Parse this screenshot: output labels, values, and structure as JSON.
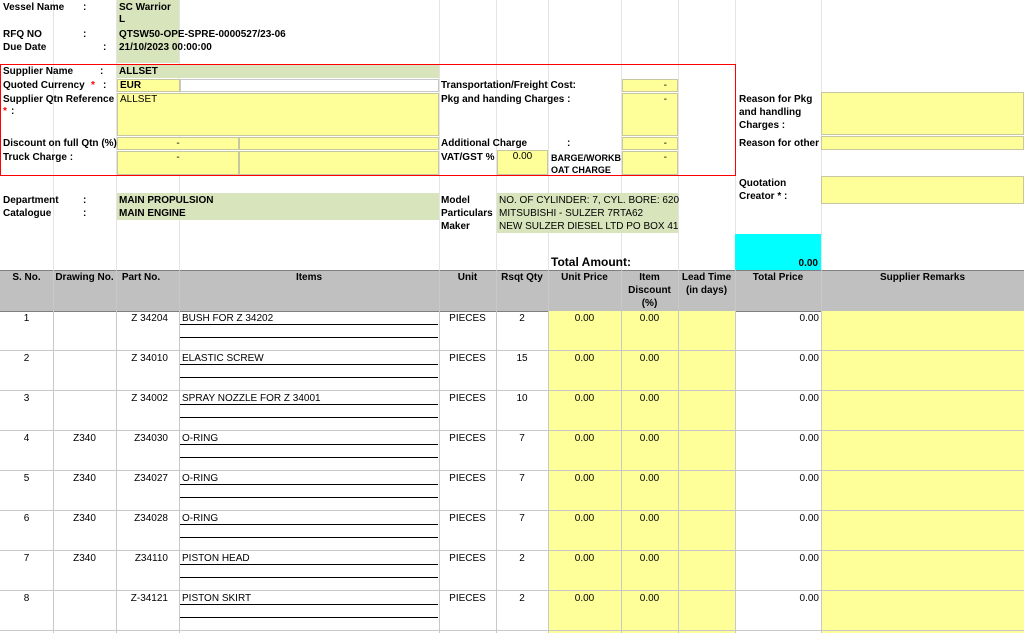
{
  "vessel": {
    "name_label": "Vessel Name",
    "name_line1": "SC Warrior",
    "name_line2": "L",
    "rfq_label": "RFQ NO",
    "rfq_value": "QTSW50-OPE-SPRE-0000527/23-06",
    "due_label": "Due Date",
    "due_value": "21/10/2023 00:00:00",
    "colon": ":"
  },
  "supplier": {
    "name_label": "Supplier Name",
    "name_value": "ALLSET",
    "currency_label": "Quoted Currency",
    "required_mark": "*",
    "currency_value": "EUR",
    "qtn_ref_label": "Supplier Qtn Reference",
    "qtn_ref_value": "ALLSET",
    "discount_label": "Discount on full Qtn  (%)",
    "discount_value": "-",
    "truck_label": "Truck Charge :",
    "truck_value": "-",
    "transport_label": "Transportation/Freight Cost:",
    "transport_value": "-",
    "pkg_label": "Pkg and handing Charges  :",
    "pkg_value": "-",
    "additional_label": "Additional Charge",
    "additional_value": "-",
    "vat_label": "VAT/GST %",
    "vat_value": "0.00",
    "barge_label_1": "BARGE/WORKB",
    "barge_label_2": "OAT CHARGE",
    "barge_value": "-"
  },
  "right_panel": {
    "reason_pkg_1": "Reason for Pkg",
    "reason_pkg_2": "and handling",
    "reason_pkg_3": "Charges :",
    "reason_other": "Reason for other",
    "creator_1": "Quotation",
    "creator_2": "Creator * :"
  },
  "info": {
    "dept_label": "Department",
    "dept_value": "MAIN PROPULSION",
    "catalogue_label": "Catalogue",
    "catalogue_value": "MAIN ENGINE",
    "model_label": "Model",
    "model_value": "NO. OF CYLINDER: 7, CYL. BORE: 620",
    "particulars_label": "Particulars",
    "particulars_value": "MITSUBISHI - SULZER 7RTA62",
    "maker_label": "Maker",
    "maker_value": "NEW SULZER DIESEL LTD PO BOX 41"
  },
  "totals": {
    "label": "Total Amount:",
    "value": "0.00"
  },
  "table": {
    "headers": {
      "sno": "S. No.",
      "drawing": "Drawing No.",
      "part": "Part No.",
      "items": "Items",
      "unit": "Unit",
      "qty": "Rsqt Qty",
      "unit_price": "Unit Price",
      "discount_1": "Item",
      "discount_2": "Discount",
      "discount_3": "(%)",
      "lead_1": "Lead Time",
      "lead_2": "(in days)",
      "total": "Total Price",
      "remarks": "Supplier Remarks"
    },
    "rows": [
      {
        "sno": "1",
        "drawing": "",
        "part": "Z 34204",
        "item": "BUSH FOR Z 34202",
        "unit": "PIECES",
        "qty": "2",
        "unit_price": "0.00",
        "discount": "0.00",
        "total": "0.00"
      },
      {
        "sno": "2",
        "drawing": "",
        "part": "Z 34010",
        "item": "ELASTIC SCREW",
        "unit": "PIECES",
        "qty": "15",
        "unit_price": "0.00",
        "discount": "0.00",
        "total": "0.00"
      },
      {
        "sno": "3",
        "drawing": "",
        "part": "Z 34002",
        "item": "SPRAY NOZZLE FOR Z 34001",
        "unit": "PIECES",
        "qty": "10",
        "unit_price": "0.00",
        "discount": "0.00",
        "total": "0.00"
      },
      {
        "sno": "4",
        "drawing": "Z340",
        "part": "Z34030",
        "item": "O-RING",
        "unit": "PIECES",
        "qty": "7",
        "unit_price": "0.00",
        "discount": "0.00",
        "total": "0.00"
      },
      {
        "sno": "5",
        "drawing": "Z340",
        "part": "Z34027",
        "item": "O-RING",
        "unit": "PIECES",
        "qty": "7",
        "unit_price": "0.00",
        "discount": "0.00",
        "total": "0.00"
      },
      {
        "sno": "6",
        "drawing": "Z340",
        "part": "Z34028",
        "item": "O-RING",
        "unit": "PIECES",
        "qty": "7",
        "unit_price": "0.00",
        "discount": "0.00",
        "total": "0.00"
      },
      {
        "sno": "7",
        "drawing": "Z340",
        "part": "Z34110",
        "item": "PISTON HEAD",
        "unit": "PIECES",
        "qty": "2",
        "unit_price": "0.00",
        "discount": "0.00",
        "total": "0.00"
      },
      {
        "sno": "8",
        "drawing": "",
        "part": "Z-34121",
        "item": "PISTON SKIRT",
        "unit": "PIECES",
        "qty": "2",
        "unit_price": "0.00",
        "discount": "0.00",
        "total": "0.00"
      }
    ]
  },
  "colors": {
    "green": "#d8e4bc",
    "yellow": "#ffff99",
    "cyan": "#00ffff",
    "header": "#c0c0c0",
    "highlight_border": "#ff0000"
  }
}
